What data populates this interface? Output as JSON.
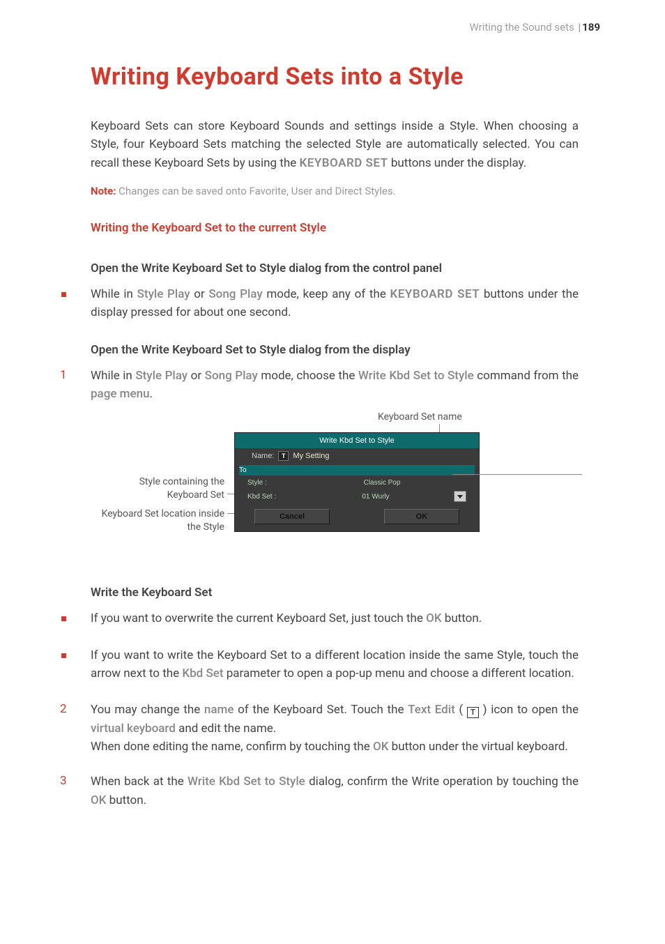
{
  "header": {
    "section": "Writing the Sound sets",
    "page": "189"
  },
  "title": "Writing Keyboard Sets into a Style",
  "intro": {
    "p1a": "Keyboard Sets can store Keyboard Sounds and settings inside a Style. When choosing a Style, four Keyboard Sets matching the selected Style are automatically selected. You can recall these Keyboard Sets by using the ",
    "kbdset": "KEYBOARD SET",
    "p1b": " buttons under the display."
  },
  "note": {
    "label": "Note:",
    "text": " Changes can be saved onto Favorite, User and Direct Styles."
  },
  "section_red": "Writing the Keyboard Set to the current Style",
  "sub1": "Open the Write Keyboard Set to Style dialog from the control panel",
  "bullet1": {
    "a": "While in ",
    "stylePlay": "Style Play",
    "or": " or ",
    "songPlay": "Song Play",
    "b": " mode, keep any of the ",
    "kbdset": "KEYBOARD SET",
    "c": " buttons under the display pressed for about one second."
  },
  "sub2": "Open the Write Keyboard Set to Style dialog from the display",
  "step1": {
    "num": "1",
    "a": "While in ",
    "stylePlay": "Style Play",
    "or": " or ",
    "songPlay": "Song Play",
    "b": " mode, choose the ",
    "cmd": "Write Kbd Set to Style",
    "c": " command from the ",
    "menu": "page menu",
    "d": "."
  },
  "callouts": {
    "top": "Keyboard Set name",
    "left1": "Style containing the Keyboard Set",
    "left2": "Keyboard Set location inside the Style"
  },
  "dialog": {
    "title": "Write Kbd Set to Style",
    "nameLabel": "Name:",
    "tIcon": "T",
    "nameValue": "My Setting",
    "to": "To",
    "styleLabel": "Style :",
    "styleValue": "Classic Pop",
    "kbdLabel": "Kbd Set :",
    "kbdValue": "01 Wurly",
    "cancel": "Cancel",
    "ok": "OK"
  },
  "sub3": "Write the Keyboard Set",
  "bullet2": {
    "a": "If you want to overwrite the current Keyboard Set, just touch the ",
    "ok": "OK",
    "b": " button."
  },
  "bullet3": {
    "a": "If you want to write the Keyboard Set to a different location inside the same Style, touch the arrow next to the ",
    "kbd": "Kbd Set",
    "b": " parameter to open a pop-up menu and choose a different location."
  },
  "step2": {
    "num": "2",
    "a": "You may change the ",
    "name": "name",
    "b": " of the Keyboard Set. Touch the ",
    "textEdit": "Text Edit",
    "paren1": " ( ",
    "tIcon": "T",
    "paren2": " ) icon to open the ",
    "vk": "virtual keyboard",
    "c": " and edit the name."
  },
  "step2b": {
    "a": "When done editing the name, confirm by touching the ",
    "ok": "OK",
    "b": " button under the virtual keyboard."
  },
  "step3": {
    "num": "3",
    "a": "When back at the ",
    "dlg": "Write Kbd Set to Style",
    "b": " dialog, confirm the Write operation by touching the ",
    "ok": "OK",
    "c": " button."
  }
}
